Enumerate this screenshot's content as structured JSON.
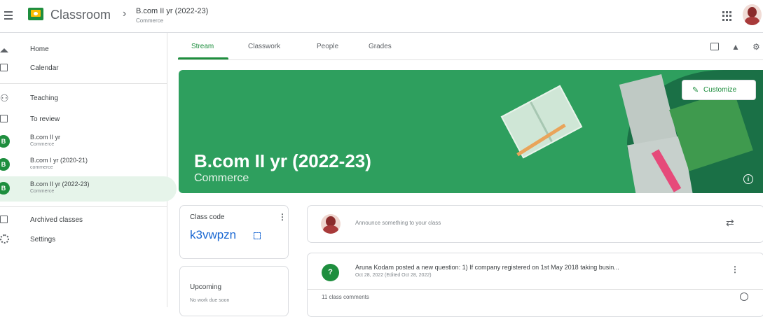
{
  "header": {
    "app_title": "Classroom",
    "breadcrumb_separator": "›",
    "class_title": "B.com II yr (2022-23)",
    "class_subtitle": "Commerce"
  },
  "sidebar": {
    "home": "Home",
    "calendar": "Calendar",
    "teaching": "Teaching",
    "to_review": "To review",
    "classes": [
      {
        "initial": "B",
        "name": "B.com II yr",
        "section": "Commerce"
      },
      {
        "initial": "B",
        "name": "B.com I yr (2020-21)",
        "section": "commerce"
      },
      {
        "initial": "B",
        "name": "B.com II yr (2022-23)",
        "section": "Commerce"
      }
    ],
    "archived": "Archived classes",
    "settings": "Settings"
  },
  "tabs": [
    "Stream",
    "Classwork",
    "People",
    "Grades"
  ],
  "banner": {
    "title": "B.com II yr (2022-23)",
    "subtitle": "Commerce",
    "customize": "Customize",
    "pen_glyph": "✎",
    "info_glyph": "i"
  },
  "class_code": {
    "label": "Class code",
    "value": "k3vwpzn",
    "more_glyph": "⋮"
  },
  "upcoming": {
    "label": "Upcoming",
    "empty": "No work due soon"
  },
  "announce": {
    "placeholder": "Announce something to your class",
    "repost_glyph": "⇄"
  },
  "post": {
    "icon_glyph": "?",
    "title": "Aruna Kodam posted a new question: 1) If company registered on 1st May 2018 taking busin...",
    "date": "Oct 28, 2022 (Edited Oct 28, 2022)",
    "more_glyph": "⋮",
    "comments": "11 class comments"
  },
  "colors": {
    "primary_green": "#1e8e3e",
    "banner_green": "#2e9f5e",
    "link_blue": "#1967d2"
  }
}
